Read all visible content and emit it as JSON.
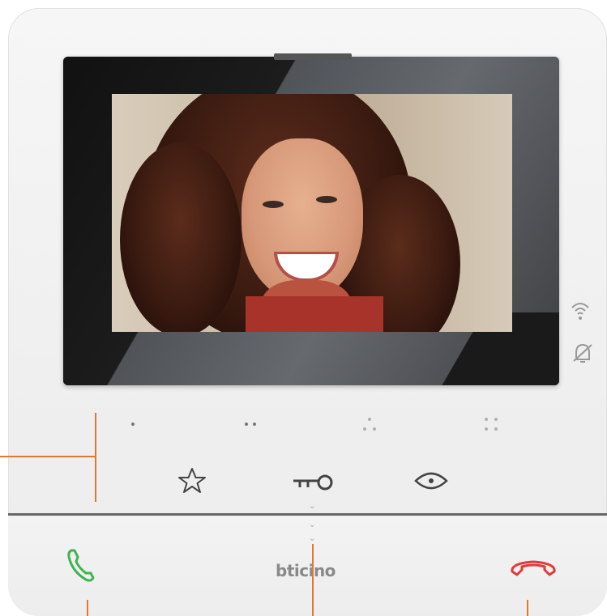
{
  "device": {
    "brand": "bticino"
  },
  "controls": {
    "answer": "answer-call",
    "hangup": "end-call",
    "favorite": "star",
    "door": "key",
    "view": "eye"
  },
  "colors": {
    "answer": "#3fb34f",
    "hangup": "#e23a3a",
    "callout": "#e07832"
  },
  "icons": [
    "wifi-icon",
    "bell-off-icon",
    "star-icon",
    "key-icon",
    "eye-icon",
    "phone-answer-icon",
    "phone-hangup-icon"
  ]
}
